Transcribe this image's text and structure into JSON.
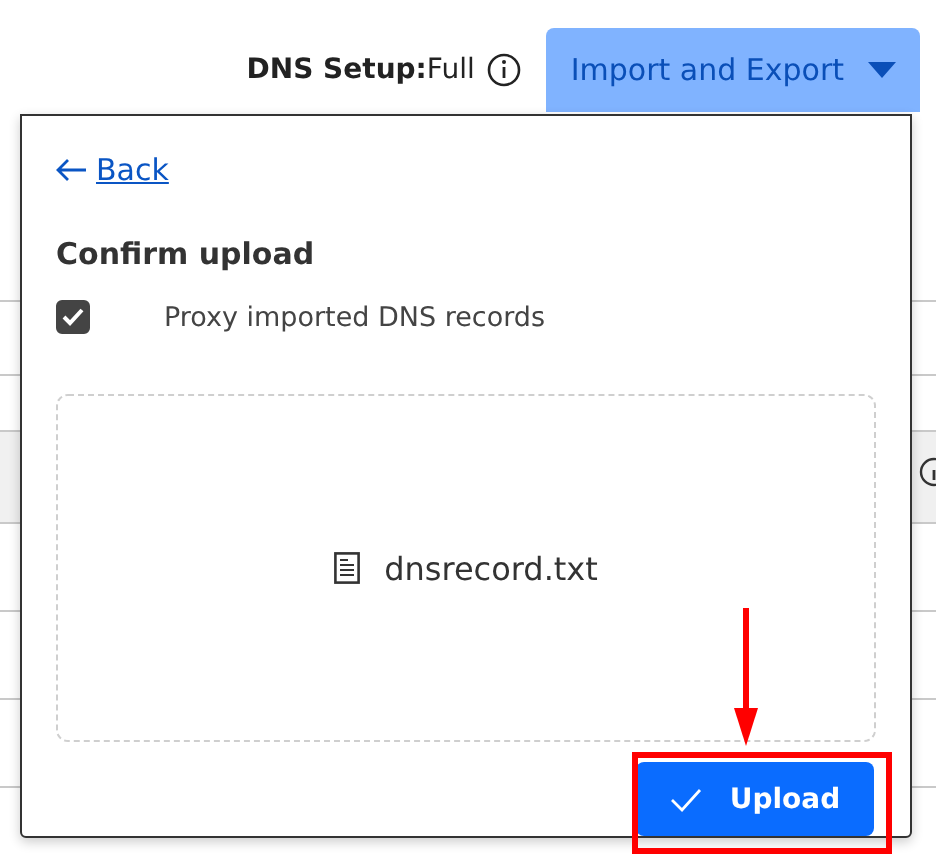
{
  "header": {
    "setup_label": "DNS Setup:",
    "setup_value": "Full",
    "menu_button": {
      "label": "Import and Export"
    }
  },
  "popup": {
    "back_link": "Back",
    "title": "Confirm upload",
    "option": {
      "label": "Proxy imported DNS records",
      "checked": true
    },
    "file": {
      "name": "dnsrecord.txt"
    },
    "upload_button": {
      "label": "Upload"
    }
  }
}
